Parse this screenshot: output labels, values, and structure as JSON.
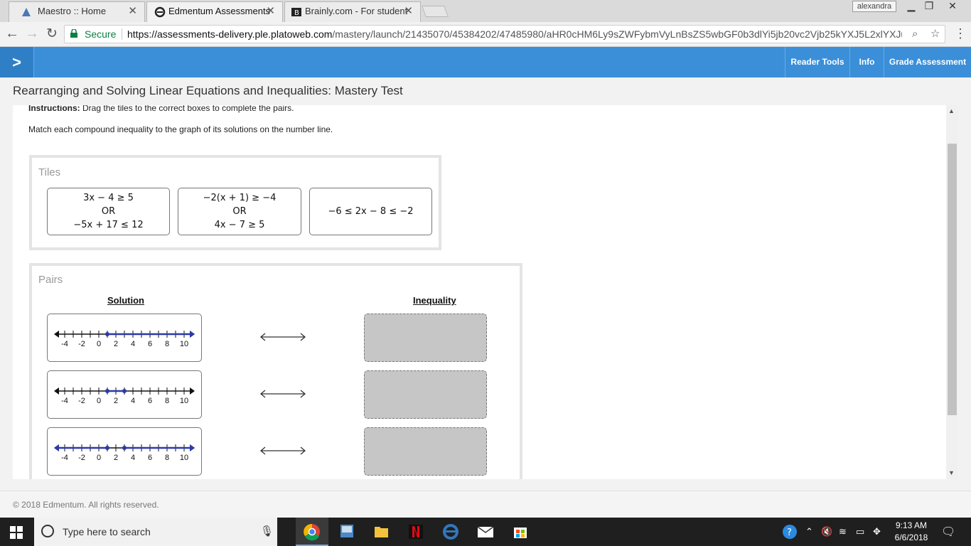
{
  "browser": {
    "tabs": [
      {
        "title": "Maestro :: Home",
        "icon": "maestro-icon"
      },
      {
        "title": "Edmentum Assessments",
        "icon": "edmentum-icon"
      },
      {
        "title": "Brainly.com - For student",
        "icon": "brainly-icon"
      }
    ],
    "profile": "alexandra",
    "secure_label": "Secure",
    "url_domain": "https://assessments-delivery.ple.platoweb.com",
    "url_path": "/mastery/launch/21435070/45384202/47485980/aHR0cHM6Ly9sZWFybmVyLnBsZS5wbGF0b3dlYi5jb20vc2Vjb25kYXJ5L2xlYXJua..."
  },
  "header": {
    "buttons": [
      "Reader Tools",
      "Info",
      "Grade Assessment"
    ],
    "accent": "#3b8fd9"
  },
  "page": {
    "title": "Rearranging and Solving Linear Equations and Inequalities: Mastery Test",
    "instructions_label": "Instructions:",
    "instructions_text": "Drag the tiles to the correct boxes to complete the pairs.",
    "prompt": "Match each compound inequality to the graph of its solutions on the number line."
  },
  "tiles": {
    "label": "Tiles",
    "items": [
      {
        "line1": "3x − 4 ≥ 5",
        "line2": "OR",
        "line3": "−5x + 17 ≤ 12"
      },
      {
        "line1": "−2(x + 1) ≥ −4",
        "line2": "OR",
        "line3": "4x − 7 ≥ 5"
      },
      {
        "line1": "−6 ≤ 2x − 8 ≤ −2",
        "line2": "",
        "line3": ""
      }
    ]
  },
  "pairs": {
    "label": "Pairs",
    "solution_header": "Solution",
    "inequality_header": "Inequality",
    "tick_labels": [
      "-4",
      "-2",
      "0",
      "2",
      "4",
      "6",
      "8",
      "10"
    ],
    "rows": [
      {
        "graph": "x ≥ 1",
        "point_a": 1,
        "point_b": null,
        "shade": "right"
      },
      {
        "graph": "1 ≤ x ≤ 3",
        "point_a": 1,
        "point_b": 3,
        "shade": "between"
      },
      {
        "graph": "x ≤ 1 or x ≥ 3",
        "point_a": 1,
        "point_b": 3,
        "shade": "outside"
      }
    ]
  },
  "footer": {
    "copyright": "© 2018 Edmentum. All rights reserved."
  },
  "taskbar": {
    "search_placeholder": "Type here to search",
    "time": "9:13 AM",
    "date": "6/6/2018"
  }
}
